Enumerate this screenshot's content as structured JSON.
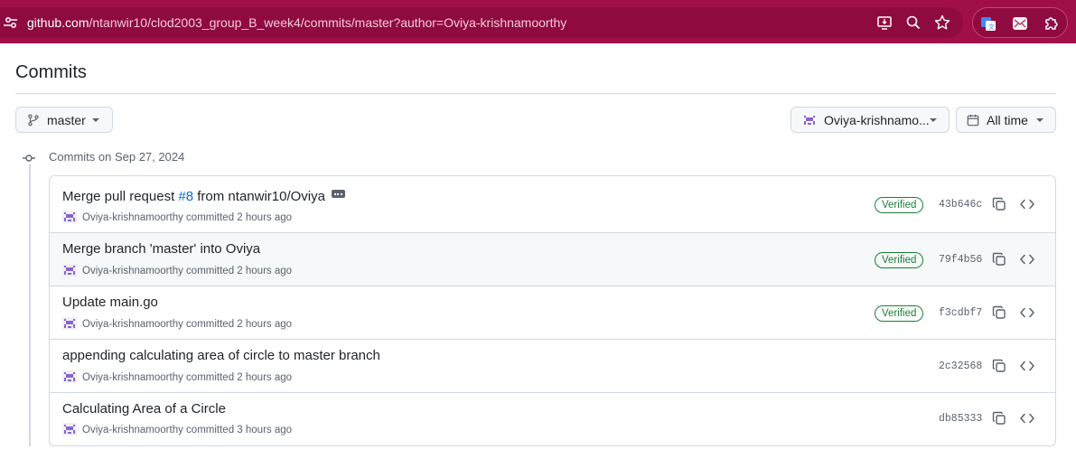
{
  "browser": {
    "url_host": "github.com",
    "url_path": "/ntanwir10/clod2003_group_B_week4/commits/master?author=Oviya-krishnamoorthy"
  },
  "page": {
    "title": "Commits"
  },
  "filters": {
    "branch": "master",
    "author": "Oviya-krishnamo...",
    "time": "All time"
  },
  "group": {
    "label": "Commits on Sep 27, 2024"
  },
  "commits": [
    {
      "message_prefix": "Merge pull request ",
      "pr_link": "#8",
      "message_suffix": " from ntanwir10/Oviya",
      "author": "Oviya-krishnamoorthy",
      "committed": "committed",
      "time": "2 hours ago",
      "verified": "Verified",
      "sha": "43b646c"
    },
    {
      "message": "Merge branch 'master' into Oviya",
      "author": "Oviya-krishnamoorthy",
      "committed": "committed",
      "time": "2 hours ago",
      "verified": "Verified",
      "sha": "79f4b56"
    },
    {
      "message": "Update main.go",
      "author": "Oviya-krishnamoorthy",
      "committed": "committed",
      "time": "2 hours ago",
      "verified": "Verified",
      "sha": "f3cdbf7"
    },
    {
      "message": "appending calculating area of circle to master branch",
      "author": "Oviya-krishnamoorthy",
      "committed": "committed",
      "time": "2 hours ago",
      "sha": "2c32568"
    },
    {
      "message": "Calculating Area of a Circle",
      "author": "Oviya-krishnamoorthy",
      "committed": "committed",
      "time": "3 hours ago",
      "sha": "db85333"
    }
  ],
  "icons": {
    "site_info": "tune-icon",
    "install": "install-app-icon",
    "zoom": "zoom-icon",
    "bookmark": "star-icon",
    "ext1": "translate-extension-icon",
    "ext2": "mail-extension-icon",
    "ext3": "puzzle-extension-icon",
    "branch": "git-branch-icon",
    "calendar": "calendar-icon",
    "copy": "copy-icon",
    "browse": "code-icon"
  },
  "colors": {
    "browser_bar": "#a10f48",
    "verified": "#1a7f37",
    "link": "#0969da"
  }
}
